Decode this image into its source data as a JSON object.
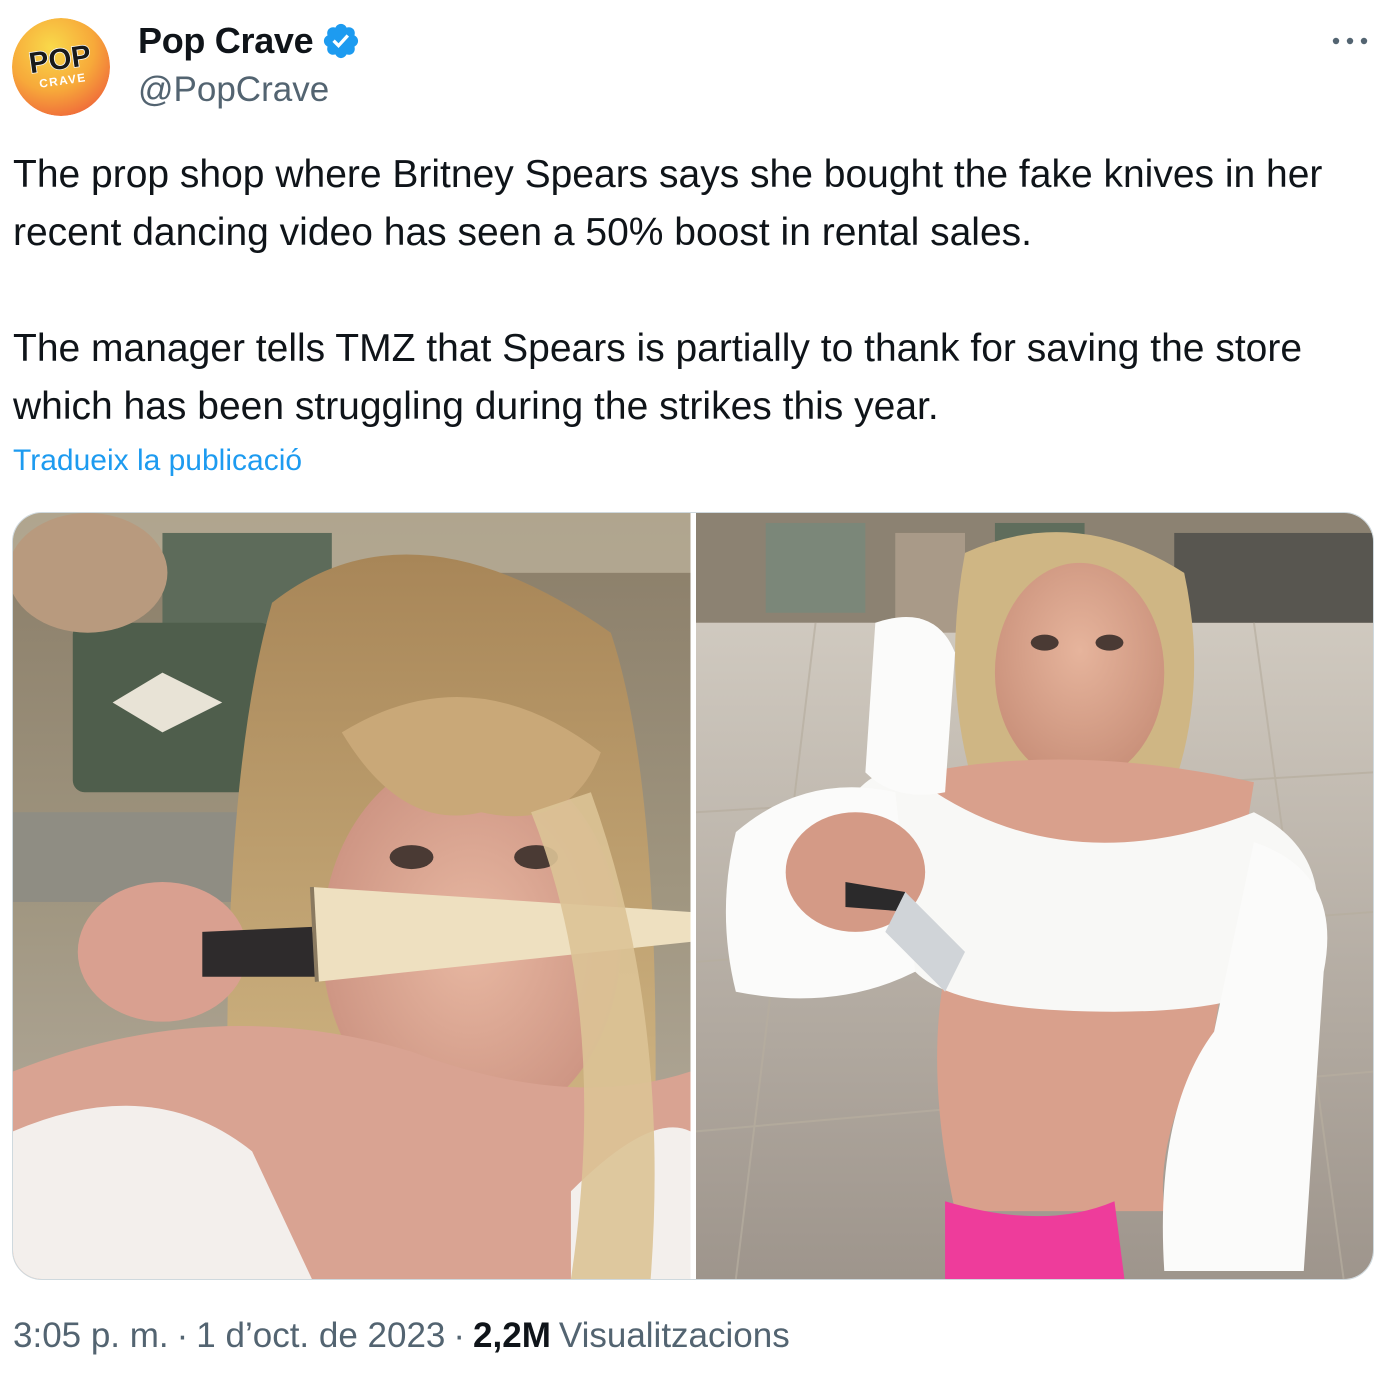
{
  "author": {
    "display_name": "Pop Crave",
    "handle": "@PopCrave",
    "verified": true,
    "avatar": {
      "logo_text_top": "POP",
      "logo_text_bottom": "CRAVE",
      "colors": {
        "bg_start": "#f7c83a",
        "bg_end": "#f06a3c",
        "text": "#1a1a1a"
      }
    }
  },
  "more_icon": "more-horizontal-icon",
  "tweet": {
    "paragraph_1": "The prop shop where Britney Spears says she bought the fake knives in her recent dancing video has seen a 50% boost in rental sales.",
    "paragraph_2": "The manager tells TMZ that Spears is partially to thank for saving the store which has been struggling during the strikes this year.",
    "translate_link": "Tradueix la publicació"
  },
  "media": {
    "count": 2
  },
  "footer": {
    "time": "3:05 p. m.",
    "separator_1": "·",
    "date": "1 d’oct. de 2023",
    "separator_2": "·",
    "views_count": "2,2M",
    "views_label": "Visualitzacions"
  },
  "colors": {
    "link": "#1d9bf0",
    "secondary_text": "#536471",
    "primary_text": "#0f1419",
    "verified_badge": "#1d9bf0"
  }
}
